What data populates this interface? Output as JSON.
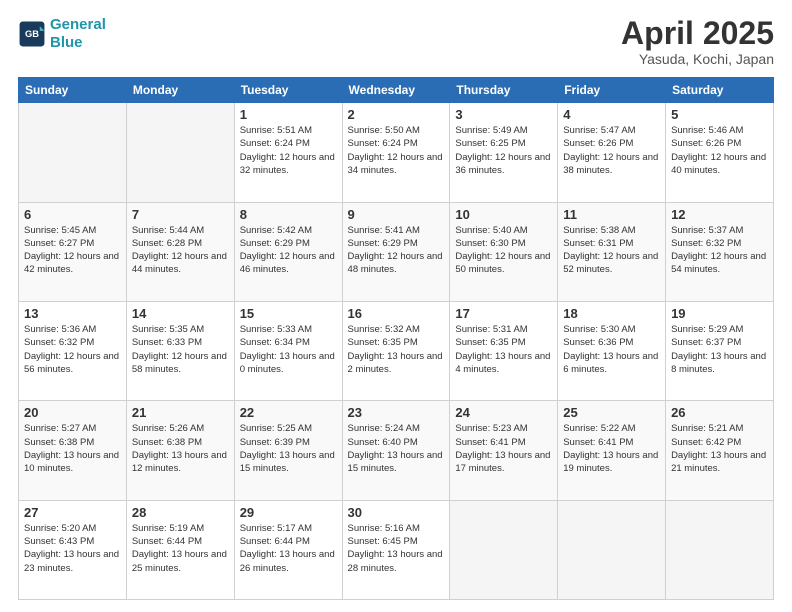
{
  "header": {
    "logo_line1": "General",
    "logo_line2": "Blue",
    "month_title": "April 2025",
    "location": "Yasuda, Kochi, Japan"
  },
  "weekdays": [
    "Sunday",
    "Monday",
    "Tuesday",
    "Wednesday",
    "Thursday",
    "Friday",
    "Saturday"
  ],
  "rows": [
    {
      "cells": [
        {
          "empty": true
        },
        {
          "empty": true
        },
        {
          "day": "1",
          "sunrise": "Sunrise: 5:51 AM",
          "sunset": "Sunset: 6:24 PM",
          "daylight": "Daylight: 12 hours and 32 minutes."
        },
        {
          "day": "2",
          "sunrise": "Sunrise: 5:50 AM",
          "sunset": "Sunset: 6:24 PM",
          "daylight": "Daylight: 12 hours and 34 minutes."
        },
        {
          "day": "3",
          "sunrise": "Sunrise: 5:49 AM",
          "sunset": "Sunset: 6:25 PM",
          "daylight": "Daylight: 12 hours and 36 minutes."
        },
        {
          "day": "4",
          "sunrise": "Sunrise: 5:47 AM",
          "sunset": "Sunset: 6:26 PM",
          "daylight": "Daylight: 12 hours and 38 minutes."
        },
        {
          "day": "5",
          "sunrise": "Sunrise: 5:46 AM",
          "sunset": "Sunset: 6:26 PM",
          "daylight": "Daylight: 12 hours and 40 minutes."
        }
      ]
    },
    {
      "cells": [
        {
          "day": "6",
          "sunrise": "Sunrise: 5:45 AM",
          "sunset": "Sunset: 6:27 PM",
          "daylight": "Daylight: 12 hours and 42 minutes."
        },
        {
          "day": "7",
          "sunrise": "Sunrise: 5:44 AM",
          "sunset": "Sunset: 6:28 PM",
          "daylight": "Daylight: 12 hours and 44 minutes."
        },
        {
          "day": "8",
          "sunrise": "Sunrise: 5:42 AM",
          "sunset": "Sunset: 6:29 PM",
          "daylight": "Daylight: 12 hours and 46 minutes."
        },
        {
          "day": "9",
          "sunrise": "Sunrise: 5:41 AM",
          "sunset": "Sunset: 6:29 PM",
          "daylight": "Daylight: 12 hours and 48 minutes."
        },
        {
          "day": "10",
          "sunrise": "Sunrise: 5:40 AM",
          "sunset": "Sunset: 6:30 PM",
          "daylight": "Daylight: 12 hours and 50 minutes."
        },
        {
          "day": "11",
          "sunrise": "Sunrise: 5:38 AM",
          "sunset": "Sunset: 6:31 PM",
          "daylight": "Daylight: 12 hours and 52 minutes."
        },
        {
          "day": "12",
          "sunrise": "Sunrise: 5:37 AM",
          "sunset": "Sunset: 6:32 PM",
          "daylight": "Daylight: 12 hours and 54 minutes."
        }
      ]
    },
    {
      "cells": [
        {
          "day": "13",
          "sunrise": "Sunrise: 5:36 AM",
          "sunset": "Sunset: 6:32 PM",
          "daylight": "Daylight: 12 hours and 56 minutes."
        },
        {
          "day": "14",
          "sunrise": "Sunrise: 5:35 AM",
          "sunset": "Sunset: 6:33 PM",
          "daylight": "Daylight: 12 hours and 58 minutes."
        },
        {
          "day": "15",
          "sunrise": "Sunrise: 5:33 AM",
          "sunset": "Sunset: 6:34 PM",
          "daylight": "Daylight: 13 hours and 0 minutes."
        },
        {
          "day": "16",
          "sunrise": "Sunrise: 5:32 AM",
          "sunset": "Sunset: 6:35 PM",
          "daylight": "Daylight: 13 hours and 2 minutes."
        },
        {
          "day": "17",
          "sunrise": "Sunrise: 5:31 AM",
          "sunset": "Sunset: 6:35 PM",
          "daylight": "Daylight: 13 hours and 4 minutes."
        },
        {
          "day": "18",
          "sunrise": "Sunrise: 5:30 AM",
          "sunset": "Sunset: 6:36 PM",
          "daylight": "Daylight: 13 hours and 6 minutes."
        },
        {
          "day": "19",
          "sunrise": "Sunrise: 5:29 AM",
          "sunset": "Sunset: 6:37 PM",
          "daylight": "Daylight: 13 hours and 8 minutes."
        }
      ]
    },
    {
      "cells": [
        {
          "day": "20",
          "sunrise": "Sunrise: 5:27 AM",
          "sunset": "Sunset: 6:38 PM",
          "daylight": "Daylight: 13 hours and 10 minutes."
        },
        {
          "day": "21",
          "sunrise": "Sunrise: 5:26 AM",
          "sunset": "Sunset: 6:38 PM",
          "daylight": "Daylight: 13 hours and 12 minutes."
        },
        {
          "day": "22",
          "sunrise": "Sunrise: 5:25 AM",
          "sunset": "Sunset: 6:39 PM",
          "daylight": "Daylight: 13 hours and 15 minutes."
        },
        {
          "day": "23",
          "sunrise": "Sunrise: 5:24 AM",
          "sunset": "Sunset: 6:40 PM",
          "daylight": "Daylight: 13 hours and 15 minutes."
        },
        {
          "day": "24",
          "sunrise": "Sunrise: 5:23 AM",
          "sunset": "Sunset: 6:41 PM",
          "daylight": "Daylight: 13 hours and 17 minutes."
        },
        {
          "day": "25",
          "sunrise": "Sunrise: 5:22 AM",
          "sunset": "Sunset: 6:41 PM",
          "daylight": "Daylight: 13 hours and 19 minutes."
        },
        {
          "day": "26",
          "sunrise": "Sunrise: 5:21 AM",
          "sunset": "Sunset: 6:42 PM",
          "daylight": "Daylight: 13 hours and 21 minutes."
        }
      ]
    },
    {
      "cells": [
        {
          "day": "27",
          "sunrise": "Sunrise: 5:20 AM",
          "sunset": "Sunset: 6:43 PM",
          "daylight": "Daylight: 13 hours and 23 minutes."
        },
        {
          "day": "28",
          "sunrise": "Sunrise: 5:19 AM",
          "sunset": "Sunset: 6:44 PM",
          "daylight": "Daylight: 13 hours and 25 minutes."
        },
        {
          "day": "29",
          "sunrise": "Sunrise: 5:17 AM",
          "sunset": "Sunset: 6:44 PM",
          "daylight": "Daylight: 13 hours and 26 minutes."
        },
        {
          "day": "30",
          "sunrise": "Sunrise: 5:16 AM",
          "sunset": "Sunset: 6:45 PM",
          "daylight": "Daylight: 13 hours and 28 minutes."
        },
        {
          "empty": true
        },
        {
          "empty": true
        },
        {
          "empty": true
        }
      ]
    }
  ]
}
